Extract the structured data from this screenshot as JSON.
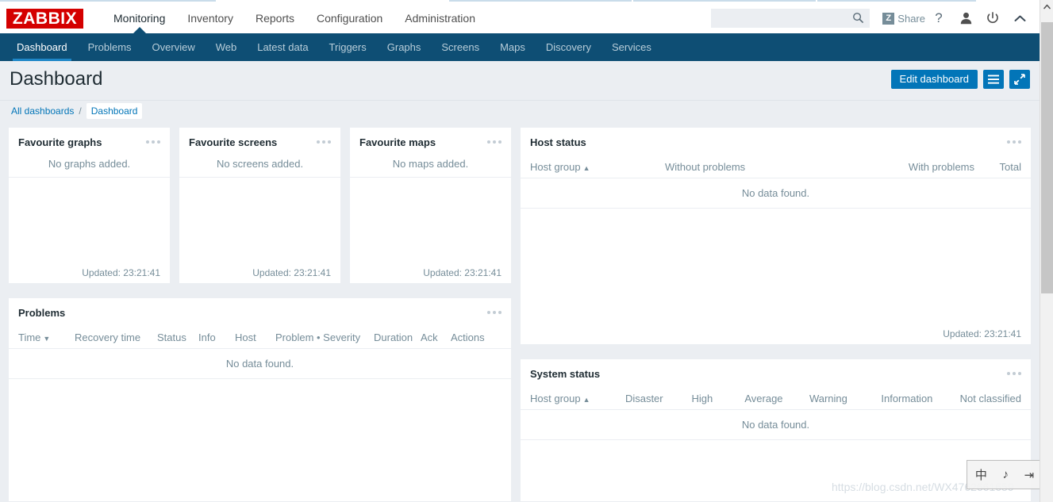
{
  "app": {
    "logo": "ZABBIX",
    "accent_blue": "#0275b8",
    "navy": "#0e4e74",
    "logo_red": "#d40000"
  },
  "header": {
    "nav": [
      {
        "label": "Monitoring",
        "selected": true
      },
      {
        "label": "Inventory",
        "selected": false
      },
      {
        "label": "Reports",
        "selected": false
      },
      {
        "label": "Configuration",
        "selected": false
      },
      {
        "label": "Administration",
        "selected": false
      }
    ],
    "search": {
      "value": "",
      "placeholder": ""
    },
    "share_label": "Share",
    "share_icon_letter": "Z",
    "icons": {
      "search": "search-icon",
      "help": "?",
      "user": "user-icon",
      "signout": "power-icon",
      "collapse": "chevron-up-icon"
    }
  },
  "subnav": {
    "items": [
      {
        "label": "Dashboard",
        "active": true
      },
      {
        "label": "Problems",
        "active": false
      },
      {
        "label": "Overview",
        "active": false
      },
      {
        "label": "Web",
        "active": false
      },
      {
        "label": "Latest data",
        "active": false
      },
      {
        "label": "Triggers",
        "active": false
      },
      {
        "label": "Graphs",
        "active": false
      },
      {
        "label": "Screens",
        "active": false
      },
      {
        "label": "Maps",
        "active": false
      },
      {
        "label": "Discovery",
        "active": false
      },
      {
        "label": "Services",
        "active": false
      }
    ]
  },
  "titlebar": {
    "title": "Dashboard",
    "edit_label": "Edit dashboard",
    "menu_icon": "hamburger-icon",
    "kiosk_icon": "expand-icon"
  },
  "breadcrumb": {
    "all_dashboards": "All dashboards",
    "separator": "/",
    "current": "Dashboard"
  },
  "widgets": {
    "favourite_graphs": {
      "title": "Favourite graphs",
      "empty": "No graphs added.",
      "updated": "Updated: 23:21:41"
    },
    "favourite_screens": {
      "title": "Favourite screens",
      "empty": "No screens added.",
      "updated": "Updated: 23:21:41"
    },
    "favourite_maps": {
      "title": "Favourite maps",
      "empty": "No maps added.",
      "updated": "Updated: 23:21:41"
    },
    "host_status": {
      "title": "Host status",
      "columns": [
        {
          "label": "Host group",
          "sort": "▲"
        },
        {
          "label": "Without problems",
          "sort": ""
        },
        {
          "label": "With problems",
          "sort": ""
        },
        {
          "label": "Total",
          "sort": ""
        }
      ],
      "empty": "No data found.",
      "updated": "Updated: 23:21:41",
      "rows": []
    },
    "problems": {
      "title": "Problems",
      "columns": [
        {
          "label": "Time",
          "sort": "▼"
        },
        {
          "label": "Recovery time",
          "sort": ""
        },
        {
          "label": "Status",
          "sort": ""
        },
        {
          "label": "Info",
          "sort": ""
        },
        {
          "label": "Host",
          "sort": ""
        },
        {
          "label": "Problem • Severity",
          "sort": ""
        },
        {
          "label": "Duration",
          "sort": ""
        },
        {
          "label": "Ack",
          "sort": ""
        },
        {
          "label": "Actions",
          "sort": ""
        }
      ],
      "empty": "No data found.",
      "rows": []
    },
    "system_status": {
      "title": "System status",
      "columns": [
        {
          "label": "Host group",
          "sort": "▲"
        },
        {
          "label": "Disaster",
          "sort": ""
        },
        {
          "label": "High",
          "sort": ""
        },
        {
          "label": "Average",
          "sort": ""
        },
        {
          "label": "Warning",
          "sort": ""
        },
        {
          "label": "Information",
          "sort": ""
        },
        {
          "label": "Not classified",
          "sort": ""
        }
      ],
      "empty": "No data found.",
      "rows": []
    }
  },
  "overlay": {
    "watermark": "https://blog.csdn.net/WX4762661659",
    "ime": [
      "中",
      "♪",
      "⇥"
    ]
  }
}
